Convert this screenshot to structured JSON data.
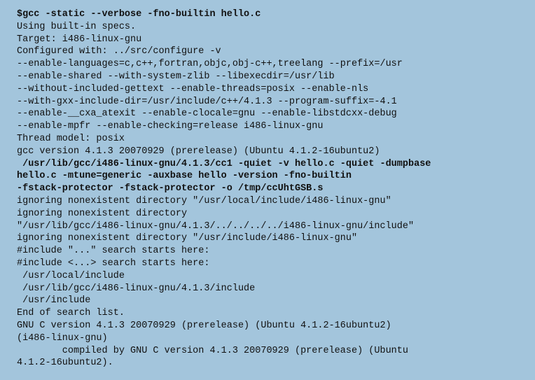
{
  "terminal": {
    "lines": [
      "$gcc -static --verbose -fno-builtin hello.c",
      "Using built-in specs.",
      "Target: i486-linux-gnu",
      "Configured with: ../src/configure -v",
      "--enable-languages=c,c++,fortran,objc,obj-c++,treelang --prefix=/usr",
      "--enable-shared --with-system-zlib --libexecdir=/usr/lib",
      "--without-included-gettext --enable-threads=posix --enable-nls",
      "--with-gxx-include-dir=/usr/include/c++/4.1.3 --program-suffix=-4.1",
      "--enable-__cxa_atexit --enable-clocale=gnu --enable-libstdcxx-debug",
      "--enable-mpfr --enable-checking=release i486-linux-gnu",
      "Thread model: posix",
      "gcc version 4.1.3 20070929 (prerelease) (Ubuntu 4.1.2-16ubuntu2)",
      " /usr/lib/gcc/i486-linux-gnu/4.1.3/cc1 -quiet -v hello.c -quiet -dumpbase",
      "hello.c -mtune=generic -auxbase hello -version -fno-builtin",
      "-fstack-protector -fstack-protector -o /tmp/ccUhtGSB.s",
      "ignoring nonexistent directory \"/usr/local/include/i486-linux-gnu\"",
      "ignoring nonexistent directory",
      "\"/usr/lib/gcc/i486-linux-gnu/4.1.3/../../../../i486-linux-gnu/include\"",
      "ignoring nonexistent directory \"/usr/include/i486-linux-gnu\"",
      "#include \"...\" search starts here:",
      "#include <...> search starts here:",
      " /usr/local/include",
      " /usr/lib/gcc/i486-linux-gnu/4.1.3/include",
      " /usr/include",
      "End of search list.",
      "GNU C version 4.1.3 20070929 (prerelease) (Ubuntu 4.1.2-16ubuntu2)",
      "(i486-linux-gnu)",
      "        compiled by GNU C version 4.1.3 20070929 (prerelease) (Ubuntu",
      "4.1.2-16ubuntu2)."
    ]
  }
}
